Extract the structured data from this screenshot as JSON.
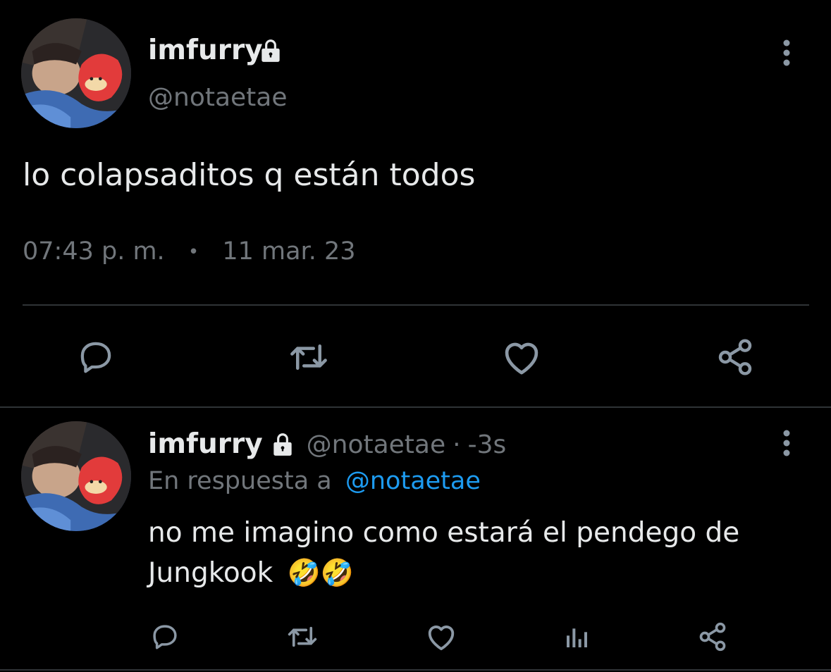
{
  "main_tweet": {
    "display_name": "imfurry",
    "handle": "@notaetae",
    "text": "lo colapsaditos q están todos",
    "time": "07:43 p. m.",
    "separator": "•",
    "date": "11 mar. 23"
  },
  "reply_tweet": {
    "display_name": "imfurry",
    "handle": "@notaetae",
    "meta_sep": "·",
    "age": "-3s",
    "reply_prefix": "En respuesta a",
    "reply_to": "@notaetae",
    "text_line1": "no me imagino como estará el pendego de",
    "text_line2": "Jungkook",
    "emojis": "🤣🤣"
  },
  "icons": {
    "lock": "lock-icon",
    "more": "more-vertical-icon",
    "reply": "reply-icon",
    "retweet": "retweet-icon",
    "like": "heart-icon",
    "share": "share-icon",
    "analytics": "analytics-icon"
  },
  "colors": {
    "background": "#000000",
    "text": "#e7e9ea",
    "muted": "#71767b",
    "link": "#1d9bf0",
    "divider": "#2f3336"
  }
}
